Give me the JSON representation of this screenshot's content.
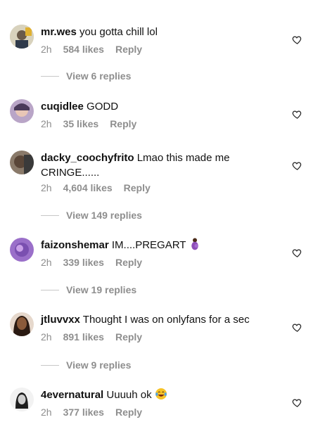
{
  "comments": [
    {
      "username": "mr.wes",
      "text": "you gotta chill lol",
      "time": "2h",
      "likes": "584 likes",
      "reply": "Reply",
      "view_replies": "View 6 replies",
      "avatar_color": "#c9c2a9"
    },
    {
      "username": "cuqidlee",
      "text": "GODD",
      "time": "2h",
      "likes": "35 likes",
      "reply": "Reply",
      "avatar_color": "#b9a5c7"
    },
    {
      "username": "dacky_coochyfrito",
      "text": "Lmao this made me CRINGE......",
      "time": "2h",
      "likes": "4,604 likes",
      "reply": "Reply",
      "view_replies": "View 149 replies",
      "avatar_color": "#6b5b4f"
    },
    {
      "username": "faizonshemar",
      "text": "IM....PREGART",
      "emoji": "pregnant-woman-emoji",
      "time": "2h",
      "likes": "339 likes",
      "reply": "Reply",
      "view_replies": "View 19 replies",
      "avatar_color": "#9a6fc9"
    },
    {
      "username": "jtluvvxx",
      "text": "Thought I was on onlyfans for a sec",
      "time": "2h",
      "likes": "891 likes",
      "reply": "Reply",
      "view_replies": "View 9 replies",
      "avatar_color": "#5a3a2a"
    },
    {
      "username": "4evernatural",
      "text": "Uuuuh ok",
      "emoji": "face-with-tears-of-joy-emoji",
      "time": "2h",
      "likes": "377 likes",
      "reply": "Reply",
      "avatar_color": "#e8e8e8"
    }
  ],
  "colors": {
    "meta_gray": "#8e8e8e",
    "text": "#111111",
    "divider": "#c7c7c7"
  }
}
